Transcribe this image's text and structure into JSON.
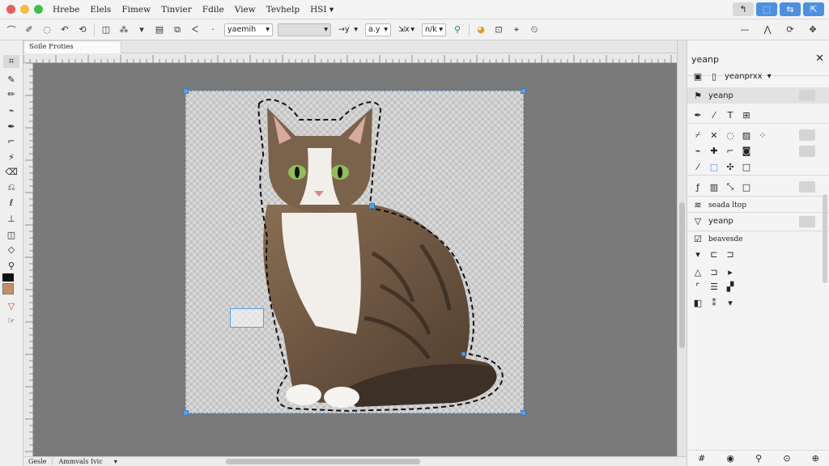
{
  "colors": {
    "close": "#ee5b5b",
    "minimize": "#f4bd3f",
    "maximize": "#3cc04a",
    "accent": "#4a90e2",
    "canvas_bg": "#7a7a7a",
    "foreground_swatch": "#111111",
    "background_swatch": "#c98d67"
  },
  "menu": [
    "Hrebe",
    "Elels",
    "Fimew",
    "Tinvier",
    "Fdile",
    "View",
    "Tevhelp",
    "HSI"
  ],
  "window_buttons": [
    "↰",
    "⬚",
    "⇆",
    "⇱",
    "✕"
  ],
  "options": {
    "mode_dropdown": "yaemih",
    "blank_dropdown": "",
    "ratio_a": "→y",
    "ratio_b": "a.y",
    "ratio_c": "a",
    "ratio_d": "⇲x",
    "ratio_e": "n/k"
  },
  "document": {
    "tab_label": "Soile Froties",
    "status_zoom": "Gesle",
    "status_info": "Ammvals Ivic"
  },
  "panel": {
    "title": "yeanp",
    "layer_dropdown": "yeanprxx",
    "section1": "yeanp",
    "section2": "seada ltop",
    "section3": "yeanp",
    "section4": "beavesde"
  },
  "toolbox_icons": [
    "move-icon",
    "brush-icon",
    "pencil-icon",
    "lasso-icon",
    "crop-icon",
    "text-icon",
    "eraser-icon",
    "clone-icon",
    "pen-icon",
    "select-icon",
    "shape-icon",
    "fill-icon",
    "eyedropper-icon"
  ],
  "image": {
    "subject": "tabby-cat"
  }
}
